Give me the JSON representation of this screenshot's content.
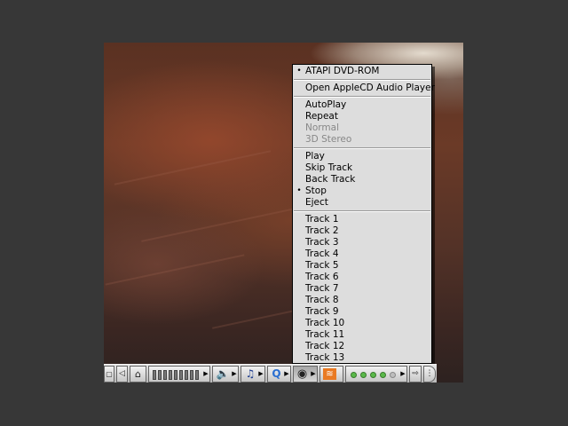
{
  "menu": {
    "drive": {
      "label": "ATAPI DVD-ROM",
      "mark": "•"
    },
    "open_player": "Open AppleCD Audio Player",
    "modes": [
      {
        "label": "AutoPlay",
        "enabled": true
      },
      {
        "label": "Repeat",
        "enabled": true
      },
      {
        "label": "Normal",
        "enabled": false
      },
      {
        "label": "3D Stereo",
        "enabled": false
      }
    ],
    "controls": [
      {
        "label": "Play",
        "mark": ""
      },
      {
        "label": "Skip Track",
        "mark": ""
      },
      {
        "label": "Back Track",
        "mark": ""
      },
      {
        "label": "Stop",
        "mark": "•"
      },
      {
        "label": "Eject",
        "mark": ""
      }
    ],
    "tracks": [
      "Track 1",
      "Track 2",
      "Track 3",
      "Track 4",
      "Track 5",
      "Track 6",
      "Track 7",
      "Track 8",
      "Track 9",
      "Track 10",
      "Track 11",
      "Track 12",
      "Track 13"
    ]
  },
  "control_strip": {
    "modules": [
      {
        "name": "collapse-box",
        "icon": "square-icon"
      },
      {
        "name": "scroll-left",
        "icon": "diamond-left-icon"
      },
      {
        "name": "file-sharing",
        "icon": "sharing-icon"
      },
      {
        "name": "monitor-bit-depth",
        "icon": "bar-meter-icon"
      },
      {
        "name": "sound-volume",
        "icon": "speaker-icon"
      },
      {
        "name": "music-cd",
        "icon": "music-note-icon"
      },
      {
        "name": "quicktime",
        "icon": "quicktime-icon"
      },
      {
        "name": "cd-strip",
        "icon": "cd-disc-icon",
        "active": true
      },
      {
        "name": "rss-feed",
        "icon": "rss-icon"
      },
      {
        "name": "level-indicator",
        "icon": "dots-icon",
        "level": "4/5"
      },
      {
        "name": "scroll-right",
        "icon": "arrow-right-icon"
      },
      {
        "name": "strip-tab",
        "icon": "tab-icon"
      }
    ],
    "colors": {
      "led_on": "#5ab94a",
      "rss": "#e97a23",
      "quicktime": "#2a6fd1"
    }
  }
}
